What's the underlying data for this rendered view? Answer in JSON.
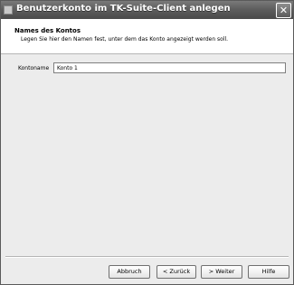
{
  "window": {
    "title": "Benutzerkonto im TK-Suite-Client anlegen",
    "close_glyph": "✕"
  },
  "header": {
    "title": "Names des Kontos",
    "description": "Legen Sie hier den Namen fest, unter dem das Konto angezeigt werden soll."
  },
  "form": {
    "account_name_label": "Kontoname",
    "account_name_value": "Konto 1"
  },
  "buttons": {
    "cancel": "Abbruch",
    "back": "< Zurück",
    "next": "> Weiter",
    "help": "Hilfe"
  }
}
